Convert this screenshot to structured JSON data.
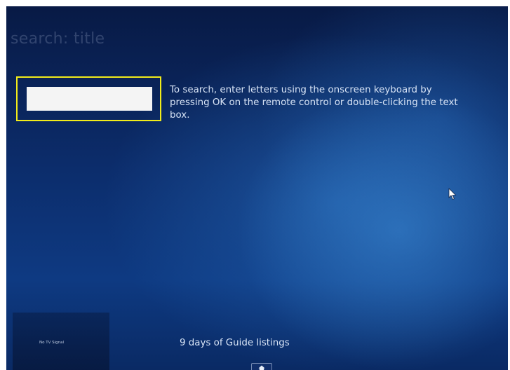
{
  "page": {
    "title": "search: title"
  },
  "search": {
    "value": "",
    "placeholder": "",
    "instructions": "To search, enter letters using the onscreen keyboard by pressing OK on the remote control or double-clicking the text box."
  },
  "status": {
    "guide_listings": "9 days of Guide listings"
  },
  "tv_preview": {
    "label": "No TV Signal"
  },
  "icons": {
    "pointer": "mouse-pointer-icon",
    "home": "home-icon"
  },
  "colors": {
    "background": "#0c2d6c",
    "focus_highlight": "#f2ec1a",
    "text": "#d8e4f6",
    "input_fill": "#f4f4f4"
  }
}
